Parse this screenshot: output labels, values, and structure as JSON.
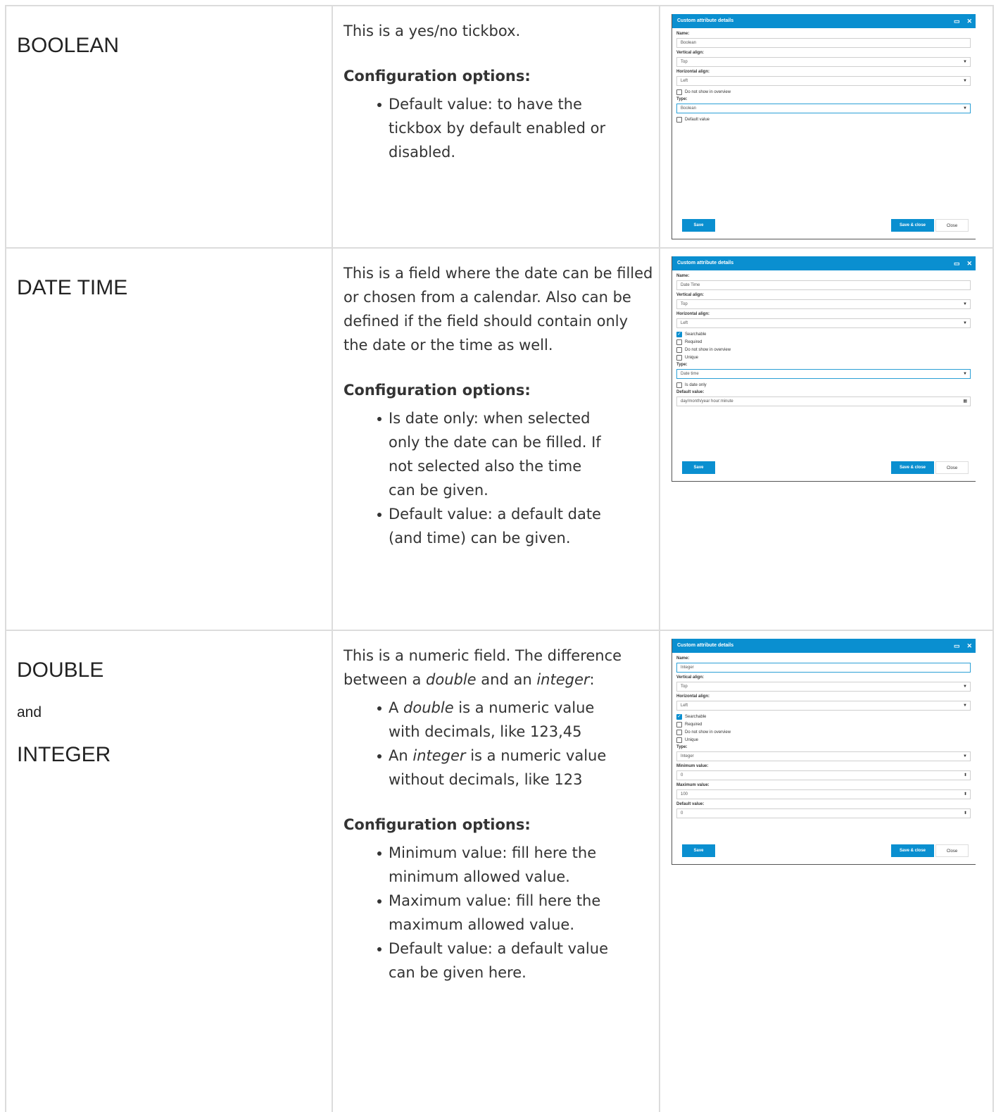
{
  "rows": [
    {
      "title": "BOOLEAN",
      "description": "This is a yes/no tickbox.",
      "config_heading": "Configuration options:",
      "options": [
        "Default value: to have the tickbox by default enabled or disabled."
      ],
      "dialog": {
        "title": "Custom attribute details",
        "name_label": "Name:",
        "name_value": "Boolean",
        "valign_label": "Vertical align:",
        "valign_value": "Top",
        "halign_label": "Horizontal align:",
        "halign_value": "Left",
        "checkbox_overview": "Do not show in overview",
        "type_label": "Type:",
        "type_value": "Boolean",
        "default_checkbox": "Default value",
        "save": "Save",
        "save_close": "Save & close",
        "close": "Close"
      }
    },
    {
      "title": "DATE TIME",
      "description": "This is a field where the date can be filled or chosen from a calendar. Also can be defined if the field should contain only the date or the time as well.",
      "config_heading": "Configuration options:",
      "options": [
        "Is date only: when selected only the date can be filled. If not selected also the time can be given.",
        "Default value: a default date (and time) can be given."
      ],
      "dialog": {
        "title": "Custom attribute details",
        "name_label": "Name:",
        "name_value": "Date Time",
        "valign_label": "Vertical align:",
        "valign_value": "Top",
        "halign_label": "Horizontal align:",
        "halign_value": "Left",
        "checkbox_searchable": "Searchable",
        "checkbox_required": "Required",
        "checkbox_overview": "Do not show in overview",
        "checkbox_unique": "Unique",
        "type_label": "Type:",
        "type_value": "Date time",
        "date_only_checkbox": "Is date only",
        "default_label": "Default value:",
        "default_placeholder": "day/month/year hour:minute",
        "save": "Save",
        "save_close": "Save & close",
        "close": "Close"
      }
    },
    {
      "title": "DOUBLE",
      "and": "and",
      "title2": "INTEGER",
      "desc_part1": "This is a numeric field. The difference between a ",
      "desc_em1": "double",
      "desc_part2": " and an ",
      "desc_em2": "integer",
      "desc_part3": ":",
      "def_items": [
        {
          "pre": "A ",
          "em": "double",
          "post": " is a numeric value with decimals, like 123,45"
        },
        {
          "pre": "An ",
          "em": "integer",
          "post": " is a numeric value without decimals, like 123"
        }
      ],
      "config_heading": "Configuration options:",
      "options": [
        "Minimum value: fill here the minimum allowed value.",
        "Maximum value: fill here the maximum allowed value.",
        "Default value: a default value can be given here."
      ],
      "dialog": {
        "title": "Custom attribute details",
        "name_label": "Name:",
        "name_value": "Integer",
        "valign_label": "Vertical align:",
        "valign_value": "Top",
        "halign_label": "Horizontal align:",
        "halign_value": "Left",
        "checkbox_searchable": "Searchable",
        "checkbox_required": "Required",
        "checkbox_overview": "Do not show in overview",
        "checkbox_unique": "Unique",
        "type_label": "Type:",
        "type_value": "Integer",
        "min_label": "Minimum value:",
        "min_value": "0",
        "max_label": "Maximum value:",
        "max_value": "100",
        "default_label": "Default value:",
        "default_value": "0",
        "save": "Save",
        "save_close": "Save & close",
        "close": "Close"
      }
    }
  ]
}
